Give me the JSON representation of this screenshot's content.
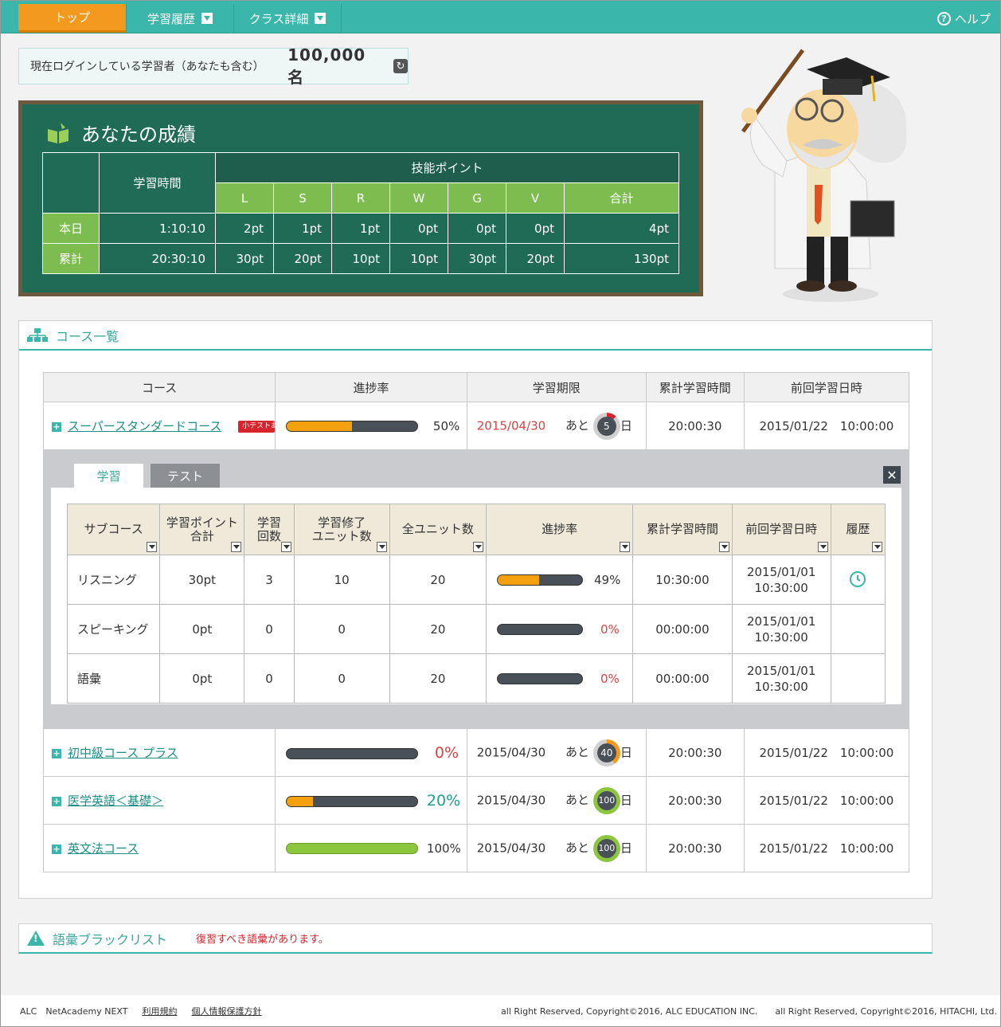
{
  "nav": {
    "tabs": [
      "トップ",
      "学習履歴",
      "クラス詳細"
    ],
    "help": "ヘルプ"
  },
  "counter": {
    "label": "現在ログインしている学習者（あなたも含む）",
    "value": "100,000名"
  },
  "score": {
    "title": "あなたの成績",
    "study_time": "学習時間",
    "skill_points": "技能ポイント",
    "skills": [
      "L",
      "S",
      "R",
      "W",
      "G",
      "V",
      "合計"
    ],
    "rows": [
      {
        "label": "本日",
        "time": "1:10:10",
        "points": [
          "2pt",
          "1pt",
          "1pt",
          "0pt",
          "0pt",
          "0pt",
          "4pt"
        ]
      },
      {
        "label": "累計",
        "time": "20:30:10",
        "points": [
          "30pt",
          "20pt",
          "10pt",
          "10pt",
          "30pt",
          "20pt",
          "130pt"
        ]
      }
    ]
  },
  "courses": {
    "heading": "コース一覧",
    "columns": [
      "コース",
      "進捗率",
      "学習期限",
      "累計学習時間",
      "前回学習日時"
    ],
    "ato": "あと",
    "day": "日",
    "list": [
      {
        "name": "スーパースタンダードコース",
        "badge": "小テストあり",
        "progress": "50%",
        "progress_value": 50,
        "deadline": "2015/04/30",
        "days": "5",
        "total": "20:00:30",
        "last": "2015/01/22　10:00:00"
      },
      {
        "name": "初中級コース プラス",
        "progress": "0%",
        "progress_value": 0,
        "deadline": "2015/04/30",
        "days": "40",
        "total": "20:00:30",
        "last": "2015/01/22　10:00:00"
      },
      {
        "name": "医学英語＜基礎＞",
        "progress": "20%",
        "progress_value": 20,
        "deadline": "2015/04/30",
        "days": "100",
        "total": "20:00:30",
        "last": "2015/01/22　10:00:00"
      },
      {
        "name": "英文法コース",
        "progress": "100%",
        "progress_value": 100,
        "deadline": "2015/04/30",
        "days": "100",
        "total": "20:00:30",
        "last": "2015/01/22　10:00:00"
      }
    ]
  },
  "detail": {
    "tabs": [
      "学習",
      "テスト"
    ],
    "columns": [
      "サブコース",
      "学習ポイント\n合計",
      "学習\n回数",
      "学習修了\nユニット数",
      "全ユニット数",
      "進捗率",
      "累計学習時間",
      "前回学習日時",
      "履歴"
    ],
    "rows": [
      {
        "name": "リスニング",
        "points": "30pt",
        "count": "3",
        "done": "10",
        "all": "20",
        "progress": "49%",
        "progress_value": 49,
        "time": "10:30:00",
        "last_date": "2015/01/01",
        "last_time": "10:30:00"
      },
      {
        "name": "スピーキング",
        "points": "0pt",
        "count": "0",
        "done": "0",
        "all": "20",
        "progress": "0%",
        "progress_value": 0,
        "time": "00:00:00",
        "last_date": "2015/01/01",
        "last_time": "10:30:00"
      },
      {
        "name": "語彙",
        "points": "0pt",
        "count": "0",
        "done": "0",
        "all": "20",
        "progress": "0%",
        "progress_value": 0,
        "time": "00:00:00",
        "last_date": "2015/01/01",
        "last_time": "10:30:00"
      }
    ]
  },
  "blacklist": {
    "title": "語彙ブラックリスト",
    "message": "復習すべき語彙があります。"
  },
  "footer": {
    "brand": "ALC　NetAcademy NEXT",
    "links": [
      "利用規約",
      "個人情報保護方針"
    ],
    "copyright": "all Right Reserved, Copyright©2016, ALC EDUCATION INC.　　all Right Reserved, Copyright©2016, HITACHI, Ltd."
  },
  "colors": {
    "accent": "#3bb6aa",
    "orange": "#f39a1e",
    "board": "#1f6b55",
    "red": "#d8242c"
  }
}
